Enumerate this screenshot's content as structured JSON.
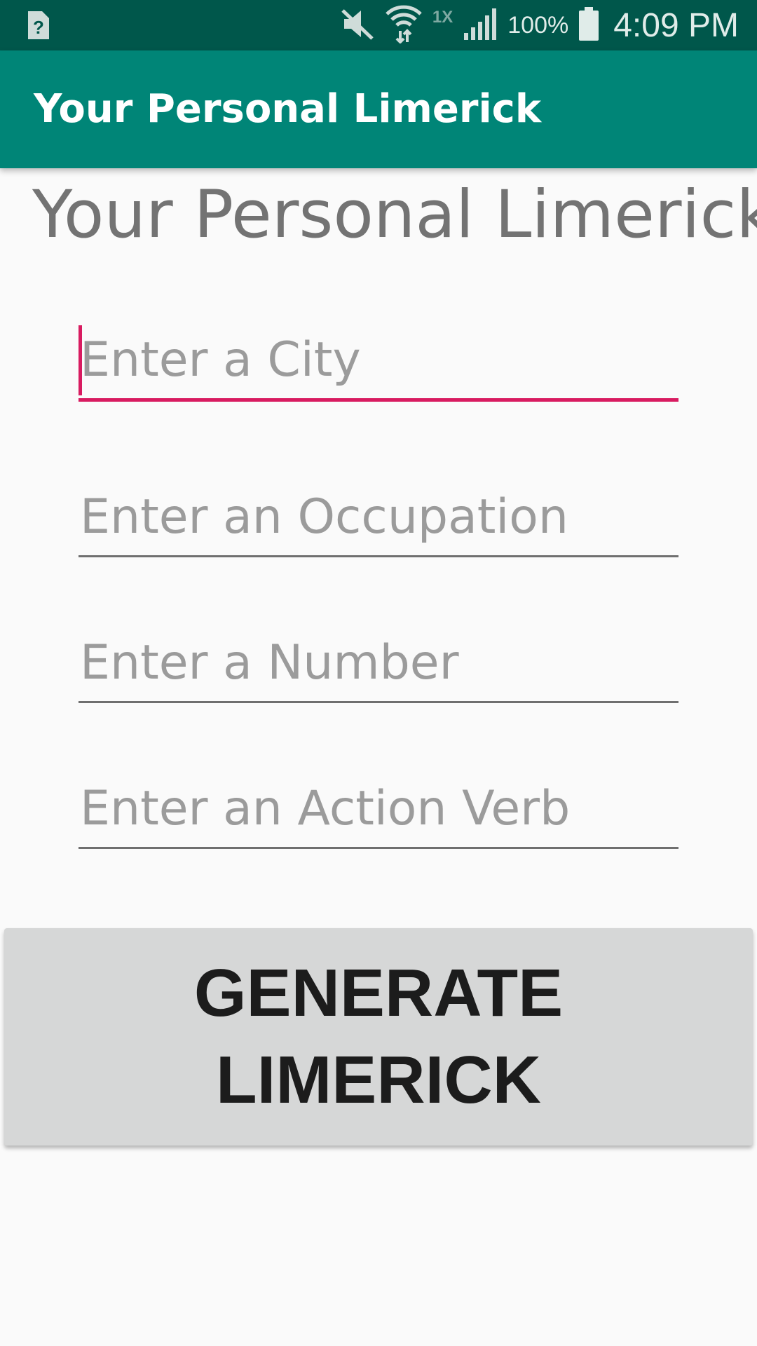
{
  "status_bar": {
    "notification_icon": "unknown-sim-icon",
    "mute_icon": "mute-icon",
    "wifi_icon": "wifi-icon",
    "network_mode": "1X",
    "signal_icon": "signal-icon",
    "battery_percent": "100%",
    "battery_icon": "battery-icon",
    "time": "4:09 PM"
  },
  "app_bar": {
    "title": "Your Personal Limerick"
  },
  "main": {
    "heading": "Your Personal Limerick",
    "fields": {
      "city": {
        "placeholder": "Enter a City",
        "value": ""
      },
      "occupation": {
        "placeholder": "Enter an Occupation",
        "value": ""
      },
      "number": {
        "placeholder": "Enter a Number",
        "value": ""
      },
      "verb": {
        "placeholder": "Enter an Action Verb",
        "value": ""
      }
    },
    "generate_button_label": "GENERATE LIMERICK"
  },
  "colors": {
    "status_bar": "#00574b",
    "app_bar": "#008577",
    "accent": "#d81b60",
    "background": "#fafafa",
    "button": "#d6d7d7"
  }
}
